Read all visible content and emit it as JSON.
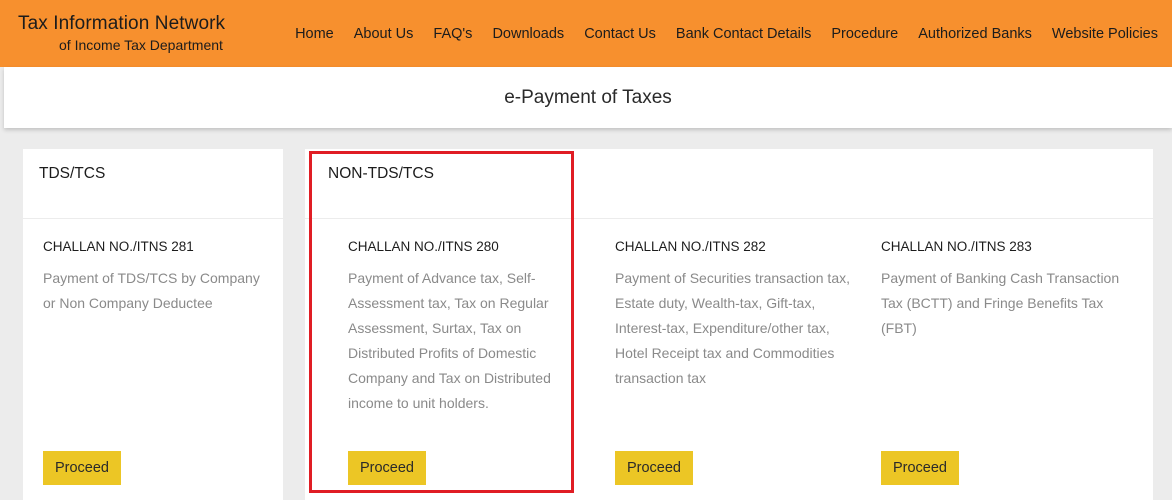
{
  "header": {
    "brand_title": "Tax Information Network",
    "brand_subtitle": "of Income Tax Department",
    "nav": [
      "Home",
      "About Us",
      "FAQ's",
      "Downloads",
      "Contact Us",
      "Bank Contact Details",
      "Procedure",
      "Authorized Banks",
      "Website Policies"
    ],
    "bar_color": "#f7902e"
  },
  "page_title": "e-Payment of Taxes",
  "panels": {
    "tds": {
      "heading": "TDS/TCS",
      "card": {
        "title": "CHALLAN NO./ITNS 281",
        "description": "Payment of TDS/TCS by Company or Non Company Deductee",
        "button": "Proceed"
      }
    },
    "nontds": {
      "heading": "NON-TDS/TCS",
      "cards": [
        {
          "title": "CHALLAN NO./ITNS 280",
          "description": "Payment of Advance tax, Self-Assessment tax, Tax on Regular Assessment, Surtax, Tax on Distributed Profits of Domestic Company and Tax on Distributed income to unit holders.",
          "button": "Proceed"
        },
        {
          "title": "CHALLAN NO./ITNS 282",
          "description": "Payment of Securities transaction tax, Estate duty, Wealth-tax, Gift-tax, Interest-tax, Expenditure/other tax, Hotel Receipt tax and Commodities transaction tax",
          "button": "Proceed"
        },
        {
          "title": "CHALLAN NO./ITNS 283",
          "description": "Payment of Banking Cash Transaction Tax (BCTT) and Fringe Benefits Tax (FBT)",
          "button": "Proceed"
        }
      ]
    }
  },
  "colors": {
    "button": "#ecc625",
    "highlight_border": "#e01d24"
  }
}
